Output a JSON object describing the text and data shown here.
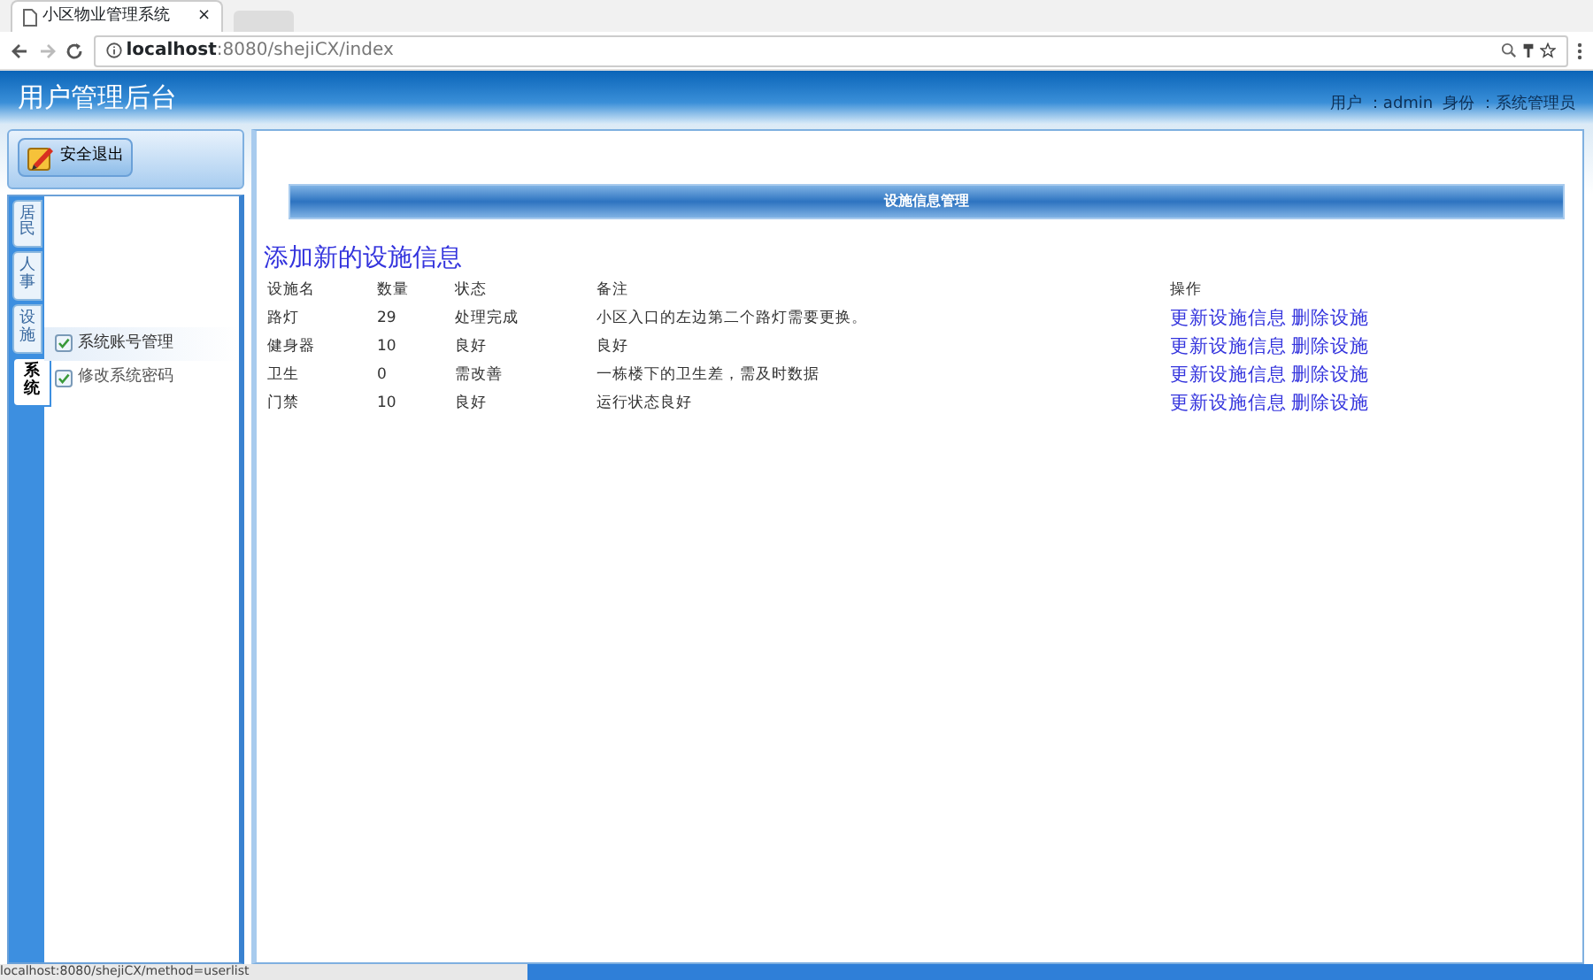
{
  "browser": {
    "tab_title": "小区物业管理系统",
    "tab_close": "×",
    "url_host": "localhost",
    "url_rest": ":8080/shejiCX/index",
    "status_url": "localhost:8080/shejiCX/method=userlist"
  },
  "header": {
    "title": "用户管理后台",
    "user_label": "用户",
    "user": "：admin",
    "role_label": "身份",
    "role": "：系统管理员"
  },
  "logout": "安全退出",
  "side_tabs": [
    {
      "label": "居民",
      "selected": false
    },
    {
      "label": "人事",
      "selected": false
    },
    {
      "label": "设施",
      "selected": false
    },
    {
      "label": "系统",
      "selected": true
    }
  ],
  "menu": [
    {
      "label": "系统账号管理",
      "selected": true
    },
    {
      "label": "修改系统密码",
      "selected": false
    }
  ],
  "panel_title": "设施信息管理",
  "add_link": "添加新的设施信息",
  "table": {
    "columns": [
      "设施名",
      "数量",
      "状态",
      "备注",
      "操作"
    ],
    "rows": [
      {
        "cells": [
          "路灯",
          "29",
          "处理完成",
          "小区入口的左边第二个路灯需要更换。"
        ],
        "actions": [
          "更新设施信息",
          "删除设施"
        ]
      },
      {
        "cells": [
          "健身器",
          "10",
          "良好",
          "良好"
        ],
        "actions": [
          "更新设施信息",
          "删除设施"
        ]
      },
      {
        "cells": [
          "卫生",
          "0",
          "需改善",
          "一栋楼下的卫生差，需及时数据"
        ],
        "actions": [
          "更新设施信息",
          "删除设施"
        ]
      },
      {
        "cells": [
          "门禁",
          "10",
          "良好",
          "运行状态良好"
        ],
        "actions": [
          "更新设施信息",
          "删除设施"
        ]
      }
    ]
  }
}
